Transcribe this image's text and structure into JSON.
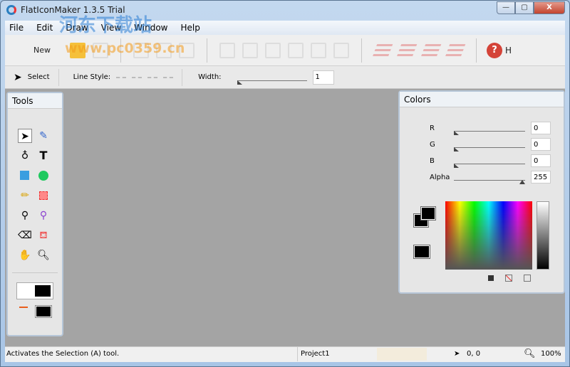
{
  "window": {
    "title": "FlatIconMaker 1.3.5 Trial",
    "min": "—",
    "max": "▢",
    "close": "X"
  },
  "menu": [
    "File",
    "Edit",
    "Draw",
    "View",
    "Window",
    "Help"
  ],
  "toolbar": {
    "new_label": "New",
    "help_label": "H",
    "help_icon": "?"
  },
  "options": {
    "select_label": "Select",
    "line_style_label": "Line Style:",
    "width_label": "Width:",
    "width_value": "1",
    "width_slider_fraction": 0
  },
  "tools_panel": {
    "title": "Tools"
  },
  "colors_panel": {
    "title": "Colors",
    "channels": [
      {
        "label": "R",
        "value": "0",
        "fraction": 0
      },
      {
        "label": "G",
        "value": "0",
        "fraction": 0
      },
      {
        "label": "B",
        "value": "0",
        "fraction": 0
      },
      {
        "label": "Alpha",
        "value": "255",
        "fraction": 1
      }
    ]
  },
  "status": {
    "message": "Activates the Selection (A) tool.",
    "project": "Project1",
    "coords": "0, 0",
    "zoom": "100%"
  },
  "watermark": {
    "text1": "河东下载站",
    "text2": "www.pc0359.cn"
  }
}
